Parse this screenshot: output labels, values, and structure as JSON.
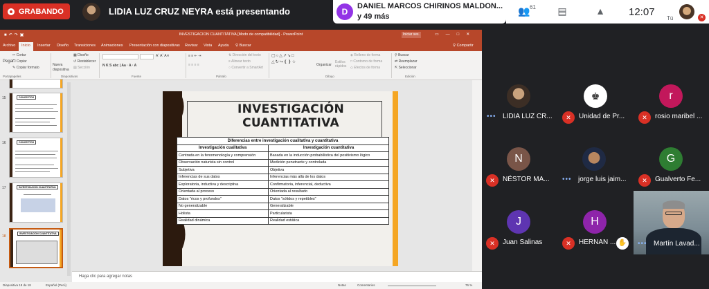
{
  "meet": {
    "recording_label": "GRABANDO",
    "presenting_text": "LIDIA LUZ CRUZ NEYRA está presentando",
    "chip_initial": "D",
    "chip_line1": "DANIEL MARCOS CHIRINOS MALDON...",
    "chip_line2": "y 49 más",
    "participant_count": "61",
    "clock": "12:07",
    "self_label": "Tú"
  },
  "ppt": {
    "window_title": "INVESTIGACION CUANTITATIVA [Modo de compatibilidad] - PowerPoint",
    "sign_in": "Iniciar ses.",
    "tabs": [
      "Archivo",
      "Inicio",
      "Insertar",
      "Diseño",
      "Transiciones",
      "Animaciones",
      "Presentación con diapositivas",
      "Revisar",
      "Vista",
      "Ayuda",
      "Buscar"
    ],
    "share": "Compartir",
    "ribbon": {
      "paste": "Pegar",
      "cut": "Cortar",
      "copy": "Copiar",
      "format_painter": "Copiar formato",
      "new_slide": "Nueva diapositiva",
      "layout": "Diseño",
      "reset": "Restablecer",
      "section": "Sección",
      "text_direction": "Dirección del texto",
      "align_text": "Alinear texto",
      "smartart": "Convertir a SmartArt",
      "arrange": "Organizar",
      "quick_styles": "Estilos rápidos",
      "shape_fill": "Relleno de forma",
      "shape_outline": "Contorno de forma",
      "shape_effects": "Efectos de forma",
      "find": "Buscar",
      "replace": "Reemplazar",
      "select": "Seleccionar",
      "groups": [
        "Portapapeles",
        "Diapositivas",
        "Fuente",
        "Párrafo",
        "Dibujo",
        "Edición"
      ]
    },
    "thumb_numbers": [
      "15",
      "16",
      "17",
      "18"
    ],
    "thumb_titles": [
      "CONCEPTOS",
      "CONCEPTOS",
      "INVESTIGACIÓN CUANTITATIVA",
      "INVESTIGACIÓN CUANTITATIVA"
    ],
    "slide": {
      "title": "INVESTIGACIÓN CUANTITATIVA",
      "table_caption": "Diferencias entre investigación cualitativa y cuantitativa",
      "col1": "Investigación cualitativa",
      "col2": "Investigación cuantitativa",
      "rows": [
        [
          "Centrada en la fenomenología y comprensión",
          "Basada en la inducción probabilística del positivismo lógico"
        ],
        [
          "Observación naturista sin control",
          "Medición penetrante y controlada"
        ],
        [
          "Subjetiva",
          "Objetiva"
        ],
        [
          "Inferencias de sus datos",
          "Inferencias más allá de los datos"
        ],
        [
          "Exploratoria, inductiva y descriptiva",
          "Confirmatoria, inferencial, deductiva"
        ],
        [
          "Orientada al proceso",
          "Orientada al resultado"
        ],
        [
          "Datos \"ricos y profundos\"",
          "Datos \"sólidos y repetibles\""
        ],
        [
          "No generalizable",
          "Generalizable"
        ],
        [
          "Holista",
          "Particularista"
        ],
        [
          "Realidad dinámica",
          "Realidad estática"
        ]
      ]
    },
    "notes_placeholder": "Haga clic para agregar notas",
    "status": {
      "slide_of": "Diapositiva 18 de 18",
      "language": "Español (Perú)",
      "notes": "Notas",
      "comments": "Comentarios",
      "zoom": "76 %"
    }
  },
  "participants": [
    {
      "name": "LIDIA LUZ CR...",
      "initial": "",
      "color": "",
      "state": "speaking"
    },
    {
      "name": "Unidad de Pr...",
      "initial": "",
      "color": "",
      "state": "muted"
    },
    {
      "name": "rosio maribel ...",
      "initial": "r",
      "color": "#c2185b",
      "state": "muted"
    },
    {
      "name": "NÉSTOR MA...",
      "initial": "N",
      "color": "#795548",
      "state": "muted"
    },
    {
      "name": "jorge luis jaim...",
      "initial": "",
      "color": "",
      "state": "speaking"
    },
    {
      "name": "Gualverto Fe...",
      "initial": "G",
      "color": "#2e7d32",
      "state": "muted"
    },
    {
      "name": "Juan Salinas",
      "initial": "J",
      "color": "#5e35b1",
      "state": "muted"
    },
    {
      "name": "HERNAN ...",
      "initial": "H",
      "color": "#8e24aa",
      "state": "muted_hand"
    },
    {
      "name": "Martín Lavad...",
      "initial": "",
      "color": "",
      "state": "speaking_video"
    }
  ]
}
